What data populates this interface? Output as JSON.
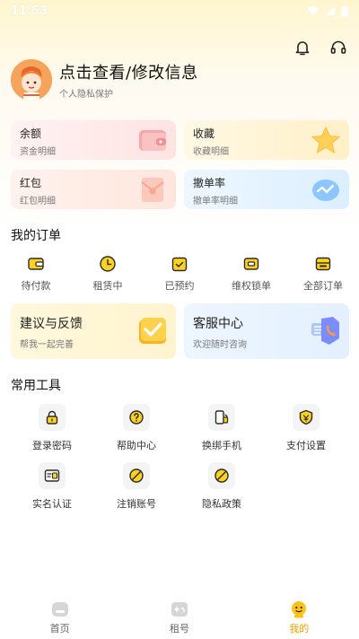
{
  "status": {
    "time": "11:53"
  },
  "profile": {
    "name": "点击查看/修改信息",
    "subtitle": "个人隐私保护"
  },
  "cards": [
    {
      "title": "余额",
      "subtitle": "资金明细",
      "icon": "wallet-icon"
    },
    {
      "title": "收藏",
      "subtitle": "收藏明细",
      "icon": "star-icon"
    },
    {
      "title": "红包",
      "subtitle": "红包明细",
      "icon": "red-envelope-icon"
    },
    {
      "title": "撤单率",
      "subtitle": "撤单率明细",
      "icon": "chart-icon"
    }
  ],
  "orders": {
    "title": "我的订单",
    "items": [
      {
        "label": "待付款",
        "icon": "wallet-icon"
      },
      {
        "label": "租赁中",
        "icon": "clock-icon"
      },
      {
        "label": "已预约",
        "icon": "calendar-icon"
      },
      {
        "label": "维权锁单",
        "icon": "lock-order-icon"
      },
      {
        "label": "全部订单",
        "icon": "list-icon"
      }
    ]
  },
  "feedback": {
    "title": "建议与反馈",
    "subtitle": "帮我一起完善"
  },
  "service": {
    "title": "客服中心",
    "subtitle": "欢迎随时咨询"
  },
  "tools": {
    "title": "常用工具",
    "items": [
      {
        "label": "登录密码",
        "icon": "lock-icon"
      },
      {
        "label": "帮助中心",
        "icon": "help-icon"
      },
      {
        "label": "换绑手机",
        "icon": "phone-icon"
      },
      {
        "label": "支付设置",
        "icon": "shield-icon"
      },
      {
        "label": "实名认证",
        "icon": "id-card-icon"
      },
      {
        "label": "注销账号",
        "icon": "cancel-icon"
      },
      {
        "label": "隐私政策",
        "icon": "policy-icon"
      }
    ]
  },
  "tabbar": {
    "items": [
      {
        "label": "首页",
        "icon": "home-icon"
      },
      {
        "label": "租号",
        "icon": "gamepad-icon"
      },
      {
        "label": "我的",
        "icon": "mine-icon"
      }
    ],
    "active": "我的"
  },
  "colors": {
    "accent": "#f2a100",
    "icon_dark": "#2b2b2b"
  }
}
